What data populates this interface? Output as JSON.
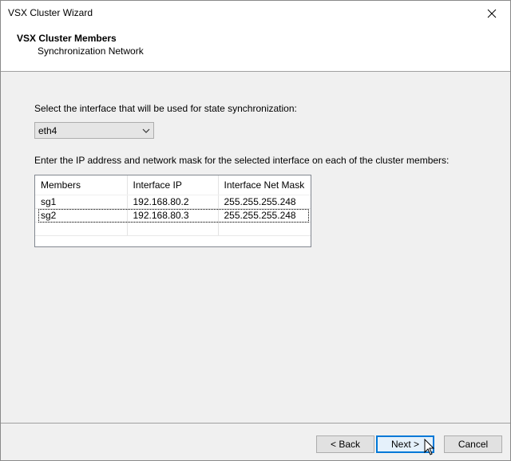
{
  "window": {
    "title": "VSX Cluster Wizard"
  },
  "header": {
    "title": "VSX Cluster Members",
    "subtitle": "Synchronization Network"
  },
  "sync": {
    "label": "Select the interface that will be used for state synchronization:",
    "selected_interface": "eth4"
  },
  "members": {
    "label": "Enter the IP address and network mask for the selected interface on each of the cluster members:",
    "columns": [
      "Members",
      "Interface IP",
      "Interface Net Mask"
    ],
    "rows": [
      {
        "member": "sg1",
        "ip": "192.168.80.2",
        "mask": "255.255.255.248"
      },
      {
        "member": "sg2",
        "ip": "192.168.80.3",
        "mask": "255.255.255.248"
      }
    ]
  },
  "buttons": {
    "back": "< Back",
    "next": "Next >",
    "cancel": "Cancel"
  },
  "icons": {
    "close": "close-icon",
    "dropdown": "chevron-down-icon",
    "cursor": "mouse-pointer-icon"
  }
}
